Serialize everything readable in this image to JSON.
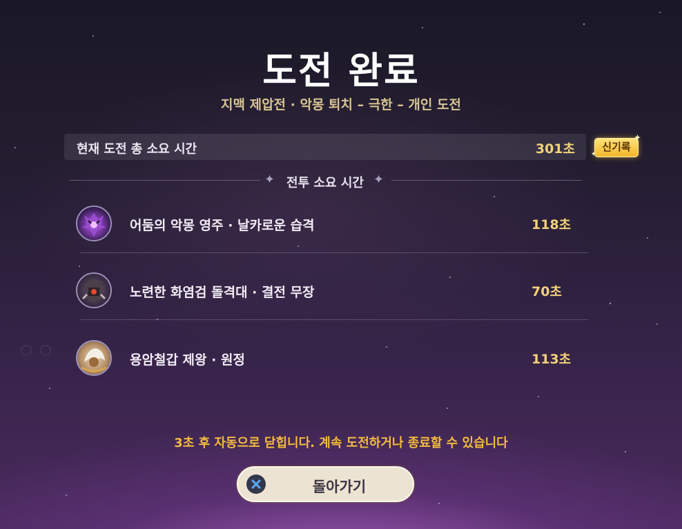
{
  "screen": {
    "title": "도전 완료",
    "subtitle": "지맥 제압전 · 악몽 퇴치 – 극한 – 개인 도전"
  },
  "total": {
    "label": "현재 도전 총 소요 시간",
    "value": "301초",
    "badge": "신기록"
  },
  "battle_time": {
    "header": "전투 소요 시간",
    "entries": [
      {
        "name": "어둠의 악몽 영주 · 날카로운 습격",
        "time": "118초",
        "icon": "dark-nightmare-lord-portrait"
      },
      {
        "name": "노련한 화염검 돌격대 · 결전 무장",
        "time": "70초",
        "icon": "flame-sword-vanguard-portrait"
      },
      {
        "name": "용암철갑 제왕 · 원정",
        "time": "113초",
        "icon": "lava-iron-emperor-portrait"
      }
    ]
  },
  "footer": {
    "auto_close": "3초 후 자동으로 닫힙니다. 계속 도전하거나 종료할 수 있습니다",
    "back_button": "돌아가기",
    "back_icon": "close-x-icon"
  },
  "colors": {
    "accent_gold": "#f3d27a",
    "subtitle_gold": "#d8c593",
    "notice_orange": "#f3bb3e",
    "badge_gold": "#f2b628",
    "button_bg": "#ece3d3"
  }
}
